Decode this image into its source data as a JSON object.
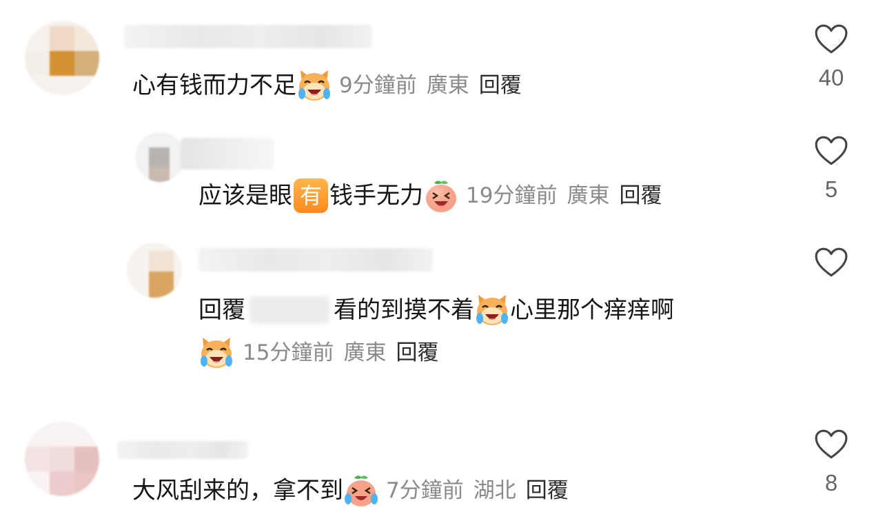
{
  "comments": [
    {
      "text": "心有钱而力不足",
      "emoji": "cat-laughing-tears-emoji",
      "time": "9分鐘前",
      "location": "廣東",
      "reply": "回覆",
      "likes": "40"
    },
    {
      "text_before": "应该是眼",
      "badge": "有",
      "text_after": "钱手无力",
      "emoji": "peach-laughing-emoji",
      "time": "19分鐘前",
      "location": "廣東",
      "reply": "回覆",
      "likes": "5"
    },
    {
      "reply_prefix": "回覆",
      "text_before": "看的到摸不着",
      "emoji": "cat-laughing-tears-emoji",
      "text_after": "心里那个痒痒啊",
      "time": "15分鐘前",
      "location": "廣東",
      "reply": "回覆",
      "likes": ""
    },
    {
      "text": "大风刮来的，拿不到",
      "emoji": "peach-crying-laughing-emoji",
      "time": "7分鐘前",
      "location": "湖北",
      "reply": "回覆",
      "likes": "8"
    }
  ]
}
